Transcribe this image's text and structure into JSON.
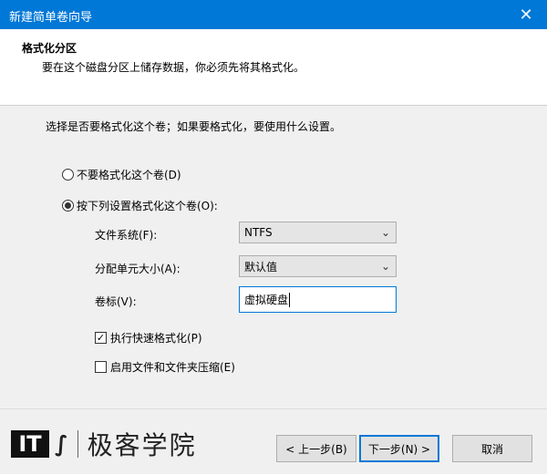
{
  "window": {
    "title": "新建简单卷向导",
    "close_symbol": "✕"
  },
  "header": {
    "title": "格式化分区",
    "subtitle": "要在这个磁盘分区上储存数据，你必须先将其格式化。"
  },
  "main": {
    "description": "选择是否要格式化这个卷；如果要格式化，要使用什么设置。",
    "options": [
      {
        "label": "不要格式化这个卷(D)",
        "checked": false
      },
      {
        "label": "按下列设置格式化这个卷(O):",
        "checked": true
      }
    ],
    "fields": {
      "filesystem": {
        "label": "文件系统(F):",
        "value": "NTFS"
      },
      "allocation": {
        "label": "分配单元大小(A):",
        "value": "默认值"
      },
      "volume_label": {
        "label": "卷标(V):",
        "value": "虚拟硬盘"
      }
    },
    "checkboxes": [
      {
        "label": "执行快速格式化(P)",
        "checked": true,
        "mark": "✓"
      },
      {
        "label": "启用文件和文件夹压缩(E)",
        "checked": false,
        "mark": ""
      }
    ]
  },
  "footer": {
    "logo": {
      "badge": "IT",
      "brand": "极客学院"
    },
    "buttons": {
      "back": "< 上一步(B)",
      "next": "下一步(N) >",
      "cancel": "取消"
    }
  },
  "colors": {
    "titlebar": "#0078d7",
    "accent": "#0078d7"
  },
  "icons": {
    "close": "close-icon",
    "dropdown": "chevron-down-icon",
    "check": "checkmark-icon"
  }
}
